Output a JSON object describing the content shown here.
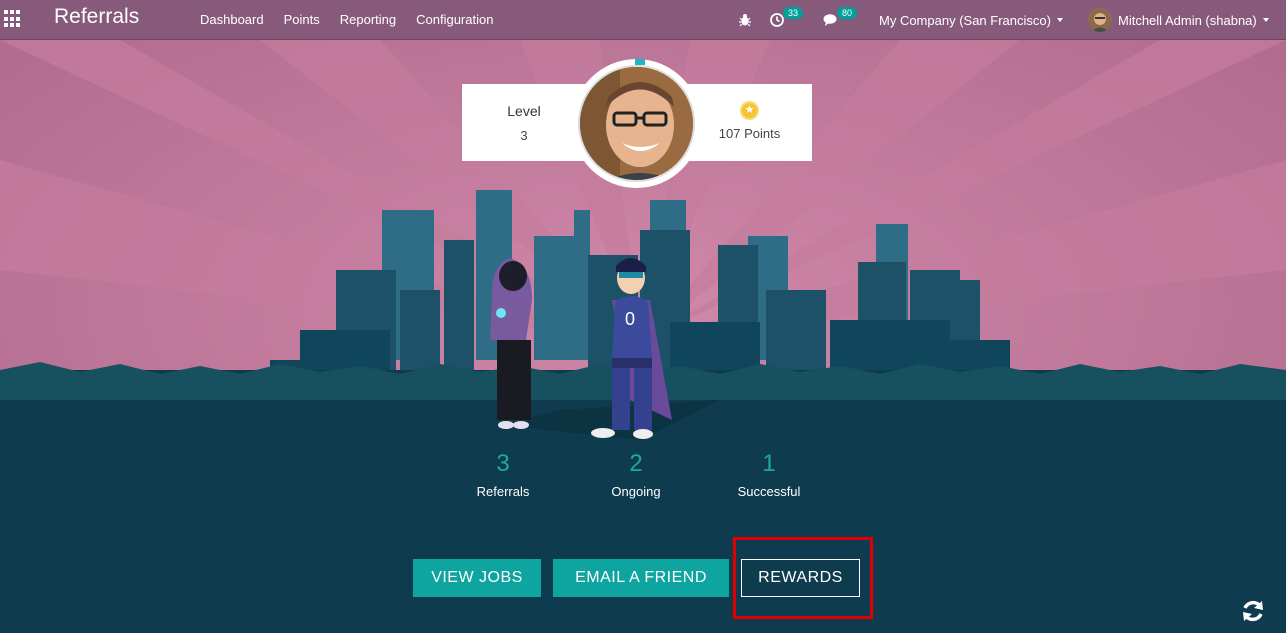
{
  "navbar": {
    "brand": "Referrals",
    "menu": [
      "Dashboard",
      "Points",
      "Reporting",
      "Configuration"
    ],
    "activity_count": "33",
    "message_count": "80",
    "company": "My Company (San Francisco)",
    "user": "Mitchell Admin (shabna)"
  },
  "profile": {
    "level_label": "Level",
    "level_value": "3",
    "points_text": "107 Points"
  },
  "stats": [
    {
      "value": "3",
      "label": "Referrals"
    },
    {
      "value": "2",
      "label": "Ongoing"
    },
    {
      "value": "1",
      "label": "Successful"
    }
  ],
  "buttons": {
    "view_jobs": "VIEW JOBS",
    "email_friend": "EMAIL A FRIEND",
    "rewards": "REWARDS"
  },
  "colors": {
    "navbar": "#875a7b",
    "sky": "#c07999",
    "accent": "#0ea5a0",
    "highlight": "#e00000"
  }
}
